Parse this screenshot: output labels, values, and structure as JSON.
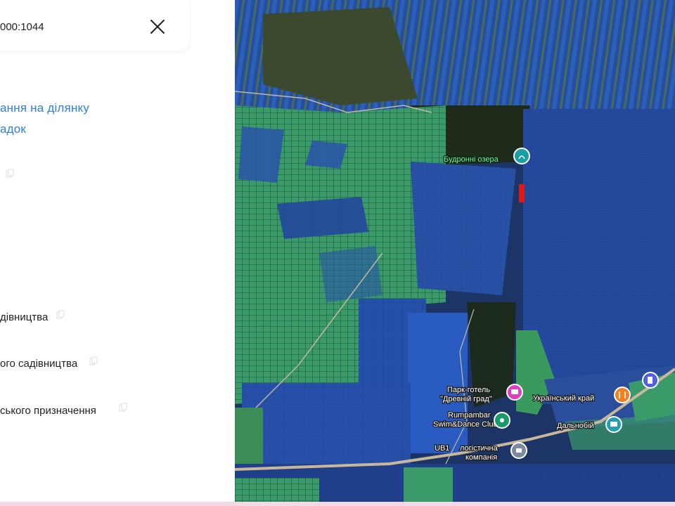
{
  "panel": {
    "search_value": "000:1044",
    "link_line_1": "ання на ділянку",
    "link_line_2": "адок",
    "field_1": "дівництва",
    "field_2": "ого садівництва",
    "field_3": "ського призначення"
  },
  "map": {
    "labels": {
      "lake": "Будронні озера",
      "hotel_1": "Парк-готель",
      "hotel_2": "\"Древній град\"",
      "ukr_krai": "Український край",
      "rumpambar_1": "Rumpambar",
      "rumpambar_2": "Swim&Dance Club",
      "logistics_1": "логістична",
      "logistics_2": "компанія",
      "ub1": "UB1",
      "dalnobii": "Дальнобій"
    }
  }
}
